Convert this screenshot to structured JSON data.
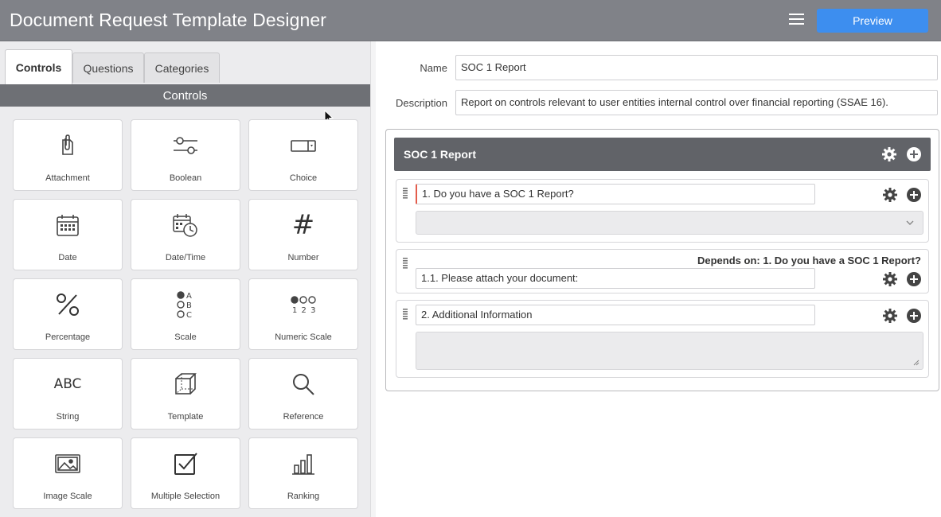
{
  "app": {
    "title": "Document Request Template Designer"
  },
  "header": {
    "menu_icon": "hamburger-menu-icon",
    "preview_label": "Preview"
  },
  "left": {
    "tabs": [
      {
        "label": "Controls",
        "active": true
      },
      {
        "label": "Questions",
        "active": false
      },
      {
        "label": "Categories",
        "active": false
      }
    ],
    "section_title": "Controls",
    "controls": [
      {
        "label": "Attachment",
        "icon": "attachment-icon"
      },
      {
        "label": "Boolean",
        "icon": "toggle-sliders-icon"
      },
      {
        "label": "Choice",
        "icon": "dropdown-select-icon"
      },
      {
        "label": "Date",
        "icon": "calendar-icon"
      },
      {
        "label": "Date/Time",
        "icon": "calendar-clock-icon"
      },
      {
        "label": "Number",
        "icon": "hash-icon"
      },
      {
        "label": "Percentage",
        "icon": "percent-icon"
      },
      {
        "label": "Scale",
        "icon": "scale-options-icon"
      },
      {
        "label": "Numeric Scale",
        "icon": "numeric-scale-icon"
      },
      {
        "label": "String",
        "icon": "abc-text-icon"
      },
      {
        "label": "Template",
        "icon": "cube-icon"
      },
      {
        "label": "Reference",
        "icon": "magnifier-icon"
      },
      {
        "label": "Image Scale",
        "icon": "image-icon"
      },
      {
        "label": "Multiple Selection",
        "icon": "checkbox-checked-icon"
      },
      {
        "label": "Ranking",
        "icon": "bar-chart-icon"
      }
    ],
    "icon_glyphs": {
      "number": "#",
      "string": "ABC",
      "scale_letters": [
        "A",
        "B",
        "C"
      ],
      "numeric_digits": "1 2 3"
    }
  },
  "form": {
    "name_label": "Name",
    "name_value": "SOC 1 Report",
    "description_label": "Description",
    "description_value": "Report on controls relevant to user entities internal control over financial reporting (SSAE 16)."
  },
  "survey": {
    "title": "SOC 1 Report",
    "questions": [
      {
        "title": "1. Do you have a SOC 1 Report?",
        "input": "dropdown"
      },
      {
        "title": "1.1. Please attach your document:",
        "depends_on": "Depends on: 1. Do you have a SOC 1 Report?"
      },
      {
        "title": "2. Additional Information",
        "input": "textarea"
      }
    ]
  },
  "colors": {
    "header_bg": "#808288",
    "accent_blue": "#3d8eef",
    "section_bar": "#6e7075",
    "survey_header": "#616368",
    "marker_red": "#e35d4c"
  }
}
